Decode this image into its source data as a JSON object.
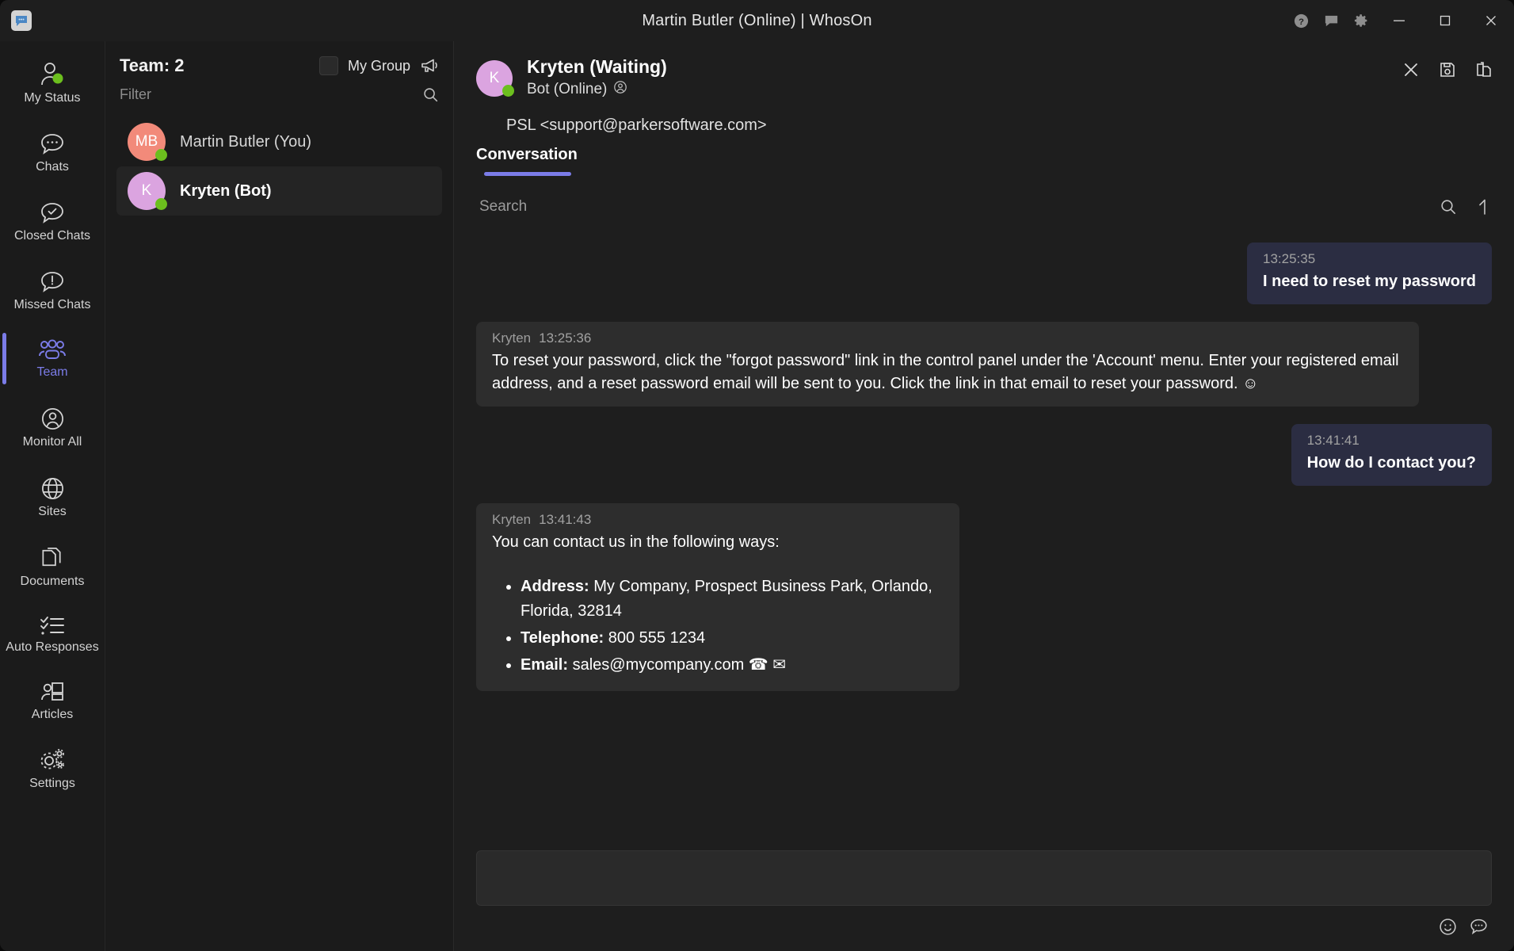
{
  "window": {
    "title": "Martin Butler (Online)  | WhosOn",
    "logo_icon": "chat-bubble-logo",
    "controls": {
      "help": "help-icon",
      "feedback": "feedback-icon",
      "settings": "settings-gear-icon",
      "minimize": "minimize-button",
      "maximize": "maximize-button",
      "close": "close-button"
    }
  },
  "sidebar": {
    "items": [
      {
        "label": "My Status",
        "icon": "user-status-icon",
        "active": false
      },
      {
        "label": "Chats",
        "icon": "chat-bubble-icon",
        "active": false
      },
      {
        "label": "Closed Chats",
        "icon": "chat-check-icon",
        "active": false
      },
      {
        "label": "Missed Chats",
        "icon": "chat-alert-icon",
        "active": false
      },
      {
        "label": "Team",
        "icon": "team-people-icon",
        "active": true
      },
      {
        "label": "Monitor All",
        "icon": "monitor-user-icon",
        "active": false
      },
      {
        "label": "Sites",
        "icon": "globe-icon",
        "active": false
      },
      {
        "label": "Documents",
        "icon": "documents-icon",
        "active": false
      },
      {
        "label": "Auto Responses",
        "icon": "checklist-icon",
        "active": false
      },
      {
        "label": "Articles",
        "icon": "articles-icon",
        "active": false
      },
      {
        "label": "Settings",
        "icon": "gears-icon",
        "active": false
      }
    ]
  },
  "team_panel": {
    "title": "Team: 2",
    "my_group_label": "My Group",
    "my_group_checked": false,
    "broadcast_icon": "megaphone-icon",
    "filter_placeholder": "Filter",
    "filter_value": "",
    "search_icon": "search-icon",
    "members": [
      {
        "name": "Martin Butler (You)",
        "initials": "MB",
        "avatar_color": "#f28a7a",
        "presence": "online",
        "selected": false
      },
      {
        "name": "Kryten (Bot)",
        "initials": "K",
        "avatar_color": "#dba4e0",
        "presence": "online",
        "selected": true
      }
    ]
  },
  "conversation": {
    "header": {
      "name": "Kryten (Waiting)",
      "status": "Bot (Online)",
      "status_icon": "user-circle-icon",
      "initials": "K",
      "avatar_color": "#dba4e0",
      "presence": "online",
      "email": "PSL <support@parkersoftware.com>",
      "actions": [
        {
          "name": "close-chat-button",
          "icon": "close-x-icon"
        },
        {
          "name": "save-chat-button",
          "icon": "save-floppy-icon"
        },
        {
          "name": "copy-chat-button",
          "icon": "copy-clipboard-icon"
        }
      ]
    },
    "tabs": [
      {
        "label": "Conversation",
        "active": true
      }
    ],
    "search": {
      "placeholder": "Search",
      "value": "",
      "search_icon": "search-icon",
      "scroll_top_icon": "arrow-up-icon"
    },
    "messages": [
      {
        "direction": "out",
        "time": "13:25:35",
        "text": "I need to reset my password"
      },
      {
        "direction": "in",
        "sender": "Kryten",
        "time": "13:25:36",
        "text": "To reset your password, click the \"forgot password\" link in the control panel under the 'Account' menu. Enter your registered email address, and a reset password email will be sent to you. Click the link in that email to reset your password. ☺"
      },
      {
        "direction": "out",
        "time": "13:41:41",
        "text": "How do I contact you?"
      },
      {
        "direction": "in",
        "sender": "Kryten",
        "time": "13:41:43",
        "text": "You can contact us in the following ways:",
        "bullets": [
          {
            "label": "Address:",
            "value": "My Company, Prospect Business Park, Orlando, Florida, 32814"
          },
          {
            "label": "Telephone:",
            "value": "800 555 1234"
          },
          {
            "label": "Email:",
            "value": "sales@mycompany.com ☎ ✉"
          }
        ]
      }
    ],
    "composer": {
      "value": "",
      "placeholder": "",
      "tools": [
        {
          "name": "emoji-button",
          "icon": "smiley-icon"
        },
        {
          "name": "canned-response-button",
          "icon": "chat-dots-icon"
        }
      ]
    }
  },
  "colors": {
    "accent": "#7b7ce8",
    "presence_online": "#6cbf1e",
    "out_bubble": "#2b2d42",
    "in_bubble": "#2d2d2d",
    "window_bg": "#1b1b1b",
    "conv_bg": "#1e1e1e"
  }
}
